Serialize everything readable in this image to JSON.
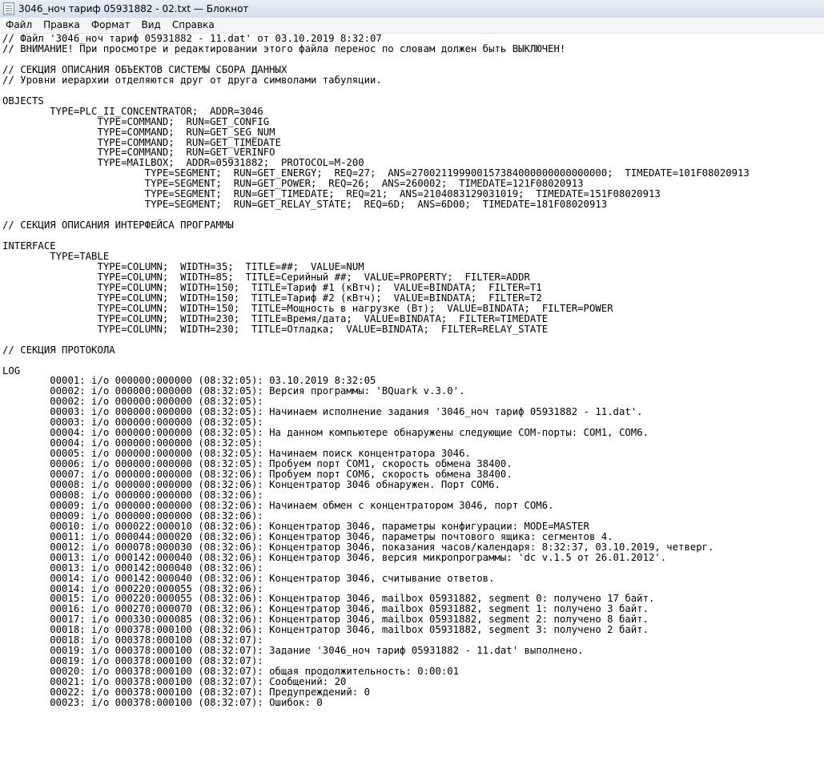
{
  "window": {
    "title": "3046_ноч тариф 05931882 - 02.txt — Блокнот"
  },
  "menu": {
    "items": [
      "Файл",
      "Правка",
      "Формат",
      "Вид",
      "Справка"
    ]
  },
  "editor": {
    "content": "// Файл '3046_ноч тариф 05931882 - 11.dat' от 03.10.2019 8:32:07\n// ВНИМАНИЕ! При просмотре и редактировании этого файла перенос по словам должен быть ВЫКЛЮЧЕН!\n\n// СЕКЦИЯ ОПИСАНИЯ ОБЪЕКТОВ СИСТЕМЫ СБОРА ДАННЫХ\n// Уровни иерархии отделяются друг от друга символами табуляции.\n\nOBJECTS\n\tTYPE=PLC_II_CONCENTRATOR;  ADDR=3046\n\t\tTYPE=COMMAND;  RUN=GET_CONFIG\n\t\tTYPE=COMMAND;  RUN=GET_SEG_NUM\n\t\tTYPE=COMMAND;  RUN=GET_TIMEDATE\n\t\tTYPE=COMMAND;  RUN=GET_VERINFO\n\t\tTYPE=MAILBOX;  ADDR=05931882;  PROTOCOL=M-200\n\t\t\tTYPE=SEGMENT;  RUN=GET_ENERGY;  REQ=27;  ANS=270021199900157384000000000000000;  TIMEDATE=101F08020913\n\t\t\tTYPE=SEGMENT;  RUN=GET_POWER;  REQ=26;  ANS=260002;  TIMEDATE=121F08020913\n\t\t\tTYPE=SEGMENT;  RUN=GET_TIMEDATE;  REQ=21;  ANS=2104083129031019;  TIMEDATE=151F08020913\n\t\t\tTYPE=SEGMENT;  RUN=GET_RELAY_STATE;  REQ=6D;  ANS=6D00;  TIMEDATE=181F08020913\n\n// СЕКЦИЯ ОПИСАНИЯ ИНТЕРФЕЙСА ПРОГРАММЫ\n\nINTERFACE\n\tTYPE=TABLE\n\t\tTYPE=COLUMN;  WIDTH=35;  TITLE=##;  VALUE=NUM\n\t\tTYPE=COLUMN;  WIDTH=85;  TITLE=Серийный ##;  VALUE=PROPERTY;  FILTER=ADDR\n\t\tTYPE=COLUMN;  WIDTH=150;  TITLE=Тариф #1 (кВтч);  VALUE=BINDATA;  FILTER=T1\n\t\tTYPE=COLUMN;  WIDTH=150;  TITLE=Тариф #2 (кВтч);  VALUE=BINDATA;  FILTER=T2\n\t\tTYPE=COLUMN;  WIDTH=150;  TITLE=Мощность в нагрузке (Вт);  VALUE=BINDATA;  FILTER=POWER\n\t\tTYPE=COLUMN;  WIDTH=230;  TITLE=Время/дата;  VALUE=BINDATA;  FILTER=TIMEDATE\n\t\tTYPE=COLUMN;  WIDTH=230;  TITLE=Отладка;  VALUE=BINDATA;  FILTER=RELAY_STATE\n\n// СЕКЦИЯ ПРОТОКОЛА\n\nLOG\n\t00001: i/o 000000:000000 (08:32:05): 03.10.2019 8:32:05\n\t00002: i/o 000000:000000 (08:32:05): Версия программы: 'BQuark v.3.0'.\n\t00002: i/o 000000:000000 (08:32:05):\n\t00003: i/o 000000:000000 (08:32:05): Начинаем исполнение задания '3046_ноч тариф 05931882 - 11.dat'.\n\t00003: i/o 000000:000000 (08:32:05):\n\t00004: i/o 000000:000000 (08:32:05): На данном компьютере обнаружены следующие COM-порты: COM1, COM6.\n\t00004: i/o 000000:000000 (08:32:05):\n\t00005: i/o 000000:000000 (08:32:05): Начинаем поиск концентратора 3046.\n\t00006: i/o 000000:000000 (08:32:05): Пробуем порт COM1, скорость обмена 38400.\n\t00007: i/o 000000:000000 (08:32:06): Пробуем порт COM6, скорость обмена 38400.\n\t00008: i/o 000000:000000 (08:32:06): Концентратор 3046 обнаружен. Порт COM6.\n\t00008: i/o 000000:000000 (08:32:06):\n\t00009: i/o 000000:000000 (08:32:06): Начинаем обмен с концентратором 3046, порт COM6.\n\t00009: i/o 000000:000000 (08:32:06):\n\t00010: i/o 000022:000010 (08:32:06): Концентратор 3046, параметры конфигурации: MODE=MASTER\n\t00011: i/o 000044:000020 (08:32:06): Концентратор 3046, параметры почтового ящика: сегментов 4.\n\t00012: i/o 000078:000030 (08:32:06): Концентратор 3046, показания часов/календаря: 8:32:37, 03.10.2019, четверг.\n\t00013: i/o 000142:000040 (08:32:06): Концентратор 3046, версия микропрограммы: 'dc v.1.5 от 26.01.2012'.\n\t00013: i/o 000142:000040 (08:32:06):\n\t00014: i/o 000142:000040 (08:32:06): Концентратор 3046, считывание ответов.\n\t00014: i/o 000220:000055 (08:32:06):\n\t00015: i/o 000220:000055 (08:32:06): Концентратор 3046, mailbox 05931882, segment 0: получено 17 байт.\n\t00016: i/o 000270:000070 (08:32:06): Концентратор 3046, mailbox 05931882, segment 1: получено 3 байт.\n\t00017: i/o 000330:000085 (08:32:06): Концентратор 3046, mailbox 05931882, segment 2: получено 8 байт.\n\t00018: i/o 000378:000100 (08:32:06): Концентратор 3046, mailbox 05931882, segment 3: получено 2 байт.\n\t00018: i/o 000378:000100 (08:32:07):\n\t00019: i/o 000378:000100 (08:32:07): Задание '3046_ноч тариф 05931882 - 11.dat' выполнено.\n\t00019: i/o 000378:000100 (08:32:07):\n\t00020: i/o 000378:000100 (08:32:07): общая продолжительность: 0:00:01\n\t00021: i/o 000378:000100 (08:32:07): Сообщений: 20\n\t00022: i/o 000378:000100 (08:32:07): Предупреждений: 0\n\t00023: i/o 000378:000100 (08:32:07): Ошибок: 0"
  }
}
